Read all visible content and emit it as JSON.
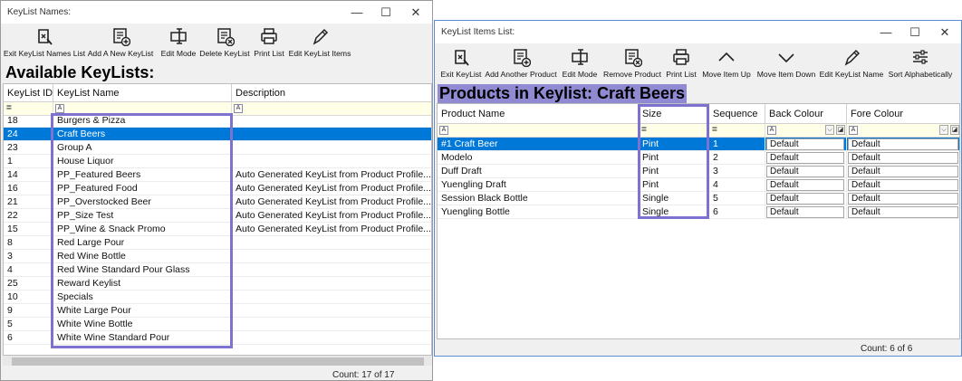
{
  "left_window": {
    "title": "KeyList Names:",
    "toolbar": [
      {
        "label": "Exit KeyList Names List",
        "icon": "exit-icon"
      },
      {
        "label": "Add A New KeyList",
        "icon": "add-new-icon"
      },
      {
        "label": "Edit Mode",
        "icon": "edit-mode-icon"
      },
      {
        "label": "Delete KeyList",
        "icon": "delete-icon"
      },
      {
        "label": "Print List",
        "icon": "printer-icon"
      },
      {
        "label": "Edit KeyList Items",
        "icon": "pencil-icon"
      }
    ],
    "heading": "Available KeyLists:",
    "columns": [
      "KeyList ID",
      "KeyList Name",
      "Description"
    ],
    "filter_symbols": {
      "eq": "=",
      "text": "A"
    },
    "rows": [
      {
        "id": "18",
        "name": "Burgers & Pizza",
        "desc": ""
      },
      {
        "id": "24",
        "name": "Craft Beers",
        "desc": ""
      },
      {
        "id": "23",
        "name": "Group A",
        "desc": ""
      },
      {
        "id": "1",
        "name": "House Liquor",
        "desc": ""
      },
      {
        "id": "14",
        "name": "PP_Featured Beers",
        "desc": "Auto Generated KeyList from Product Profile..."
      },
      {
        "id": "16",
        "name": "PP_Featured Food",
        "desc": "Auto Generated KeyList from Product Profile..."
      },
      {
        "id": "21",
        "name": "PP_Overstocked Beer",
        "desc": "Auto Generated KeyList from Product Profile..."
      },
      {
        "id": "22",
        "name": "PP_Size Test",
        "desc": "Auto Generated KeyList from Product Profile..."
      },
      {
        "id": "15",
        "name": "PP_Wine & Snack Promo",
        "desc": "Auto Generated KeyList from Product Profile..."
      },
      {
        "id": "8",
        "name": "Red Large Pour",
        "desc": ""
      },
      {
        "id": "3",
        "name": "Red Wine Bottle",
        "desc": ""
      },
      {
        "id": "4",
        "name": "Red Wine Standard Pour Glass",
        "desc": ""
      },
      {
        "id": "25",
        "name": "Reward Keylist",
        "desc": ""
      },
      {
        "id": "10",
        "name": "Specials",
        "desc": ""
      },
      {
        "id": "9",
        "name": "White Large Pour",
        "desc": ""
      },
      {
        "id": "5",
        "name": "White Wine Bottle",
        "desc": ""
      },
      {
        "id": "6",
        "name": "White Wine Standard Pour",
        "desc": ""
      }
    ],
    "selected_index": 1,
    "status": "Count: 17 of 17"
  },
  "right_window": {
    "title": "KeyList Items List:",
    "toolbar": [
      {
        "label": "Exit KeyList",
        "icon": "exit-icon"
      },
      {
        "label": "Add Another Product",
        "icon": "add-new-icon"
      },
      {
        "label": "Edit Mode",
        "icon": "edit-mode-icon"
      },
      {
        "label": "Remove Product",
        "icon": "delete-icon"
      },
      {
        "label": "Print List",
        "icon": "printer-icon"
      },
      {
        "label": "Move Item Up",
        "icon": "chevron-up-icon"
      },
      {
        "label": "Move Item Down",
        "icon": "chevron-down-icon"
      },
      {
        "label": "Edit KeyList Name",
        "icon": "pencil-icon"
      },
      {
        "label": "Sort Alphabetically",
        "icon": "sliders-icon"
      }
    ],
    "heading": "Products in Keylist: Craft Beers",
    "columns": [
      "Product Name",
      "Size",
      "Sequence",
      "Back Colour",
      "Fore Colour"
    ],
    "filter_symbols": {
      "eq": "=",
      "text": "A",
      "dropdown": "⌵"
    },
    "rows": [
      {
        "name": "#1 Craft Beer",
        "size": "Pint",
        "seq": "1",
        "back": "Default",
        "fore": "Default"
      },
      {
        "name": "Modelo",
        "size": "Pint",
        "seq": "2",
        "back": "Default",
        "fore": "Default"
      },
      {
        "name": "Duff Draft",
        "size": "Pint",
        "seq": "3",
        "back": "Default",
        "fore": "Default"
      },
      {
        "name": "Yuengling Draft",
        "size": "Pint",
        "seq": "4",
        "back": "Default",
        "fore": "Default"
      },
      {
        "name": "Session Black Bottle",
        "size": "Single",
        "seq": "5",
        "back": "Default",
        "fore": "Default"
      },
      {
        "name": "Yuengling Bottle",
        "size": "Single",
        "seq": "6",
        "back": "Default",
        "fore": "Default"
      }
    ],
    "selected_index": 0,
    "status": "Count: 6 of 6"
  },
  "colors": {
    "selection": "#0078d7",
    "highlight_box": "#7d72d0",
    "heading_bg": "#8f8ad2",
    "filter_row": "#ffffe8"
  }
}
